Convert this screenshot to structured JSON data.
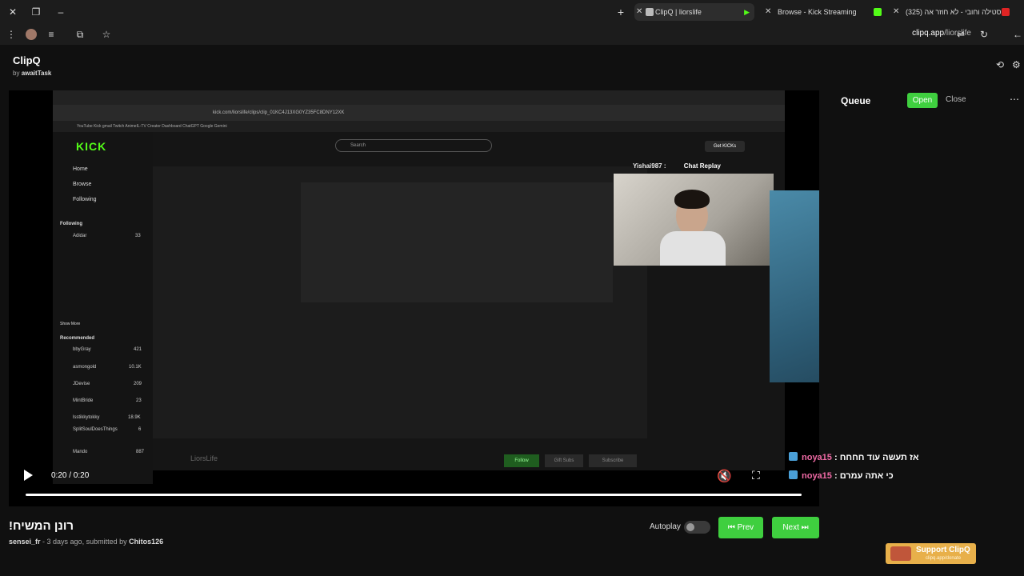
{
  "browser": {
    "tabs": [
      {
        "label": "ClipQ | liorslife",
        "active": true
      },
      {
        "label": "Browse - Kick Streaming",
        "active": false
      },
      {
        "label": "(325) סטילה וחובי - לא חוזר אה",
        "active": false
      }
    ],
    "url_domain": "clipq.app",
    "url_path": "/liorslife"
  },
  "app": {
    "title": "ClipQ",
    "by_prefix": "by",
    "by_author": "awaitTask"
  },
  "video_content": {
    "inner_url": "kick.com/liorslife/clips/clip_01KC4J13XG0YZ35FC8DNY12XK",
    "inner_bookmarks": "YouTube   Kick   gmail   Twitch   AnimeIL-TV   Creator Dashboard   ChatGPT   Google Gemini",
    "kick_logo": "KICK",
    "search_placeholder": "Search",
    "nav": [
      "Home",
      "Browse",
      "Following"
    ],
    "following_header": "Following",
    "recommended_header": "Recommended",
    "show_more": "Show More",
    "channels": [
      {
        "name": "Adidar",
        "count": "33"
      },
      {
        "name": "bbyGray",
        "count": "421"
      },
      {
        "name": "asmongold",
        "count": "10.1K"
      },
      {
        "name": "JDevise",
        "count": "209"
      },
      {
        "name": "MintBride",
        "count": "23"
      },
      {
        "name": "lsstikkytokky",
        "count": "18.9K"
      },
      {
        "name": "SplitSoulDoesThings",
        "count": "6"
      },
      {
        "name": "Mando",
        "count": "887"
      }
    ],
    "chat_replay_user": "Yishai987 :",
    "chat_replay_label": "Chat Replay",
    "streamer": "LiorsLife",
    "follow": "Follow",
    "gift_subs": "Gift Subs",
    "subscribe": "Subscribe",
    "get_kicks": "Get KICKs"
  },
  "player": {
    "time": "0:20 / 0:20",
    "progress": 1.0
  },
  "overlay_chat": [
    {
      "user": "noya15",
      "message": "אז תעשה עוד חחחח"
    },
    {
      "user": "noya15",
      "message": "כי אתה עמרם"
    }
  ],
  "clip": {
    "title": "!רונן המשיח",
    "author": "sensei_fr",
    "age": " - 3 days ago, submitted by ",
    "submitter": "Chitos126"
  },
  "controls": {
    "autoplay_label": "Autoplay",
    "autoplay_on": false,
    "prev_label": "Prev",
    "next_label": "Next"
  },
  "queue": {
    "title": "Queue",
    "open_label": "Open",
    "close_label": "Close"
  },
  "support": {
    "label": "Support ClipQ",
    "sub": "clipq.app/donate"
  },
  "colors": {
    "accent": "#3fcf3f",
    "kick_green": "#53fc18",
    "chat_name": "#f06aa5"
  }
}
